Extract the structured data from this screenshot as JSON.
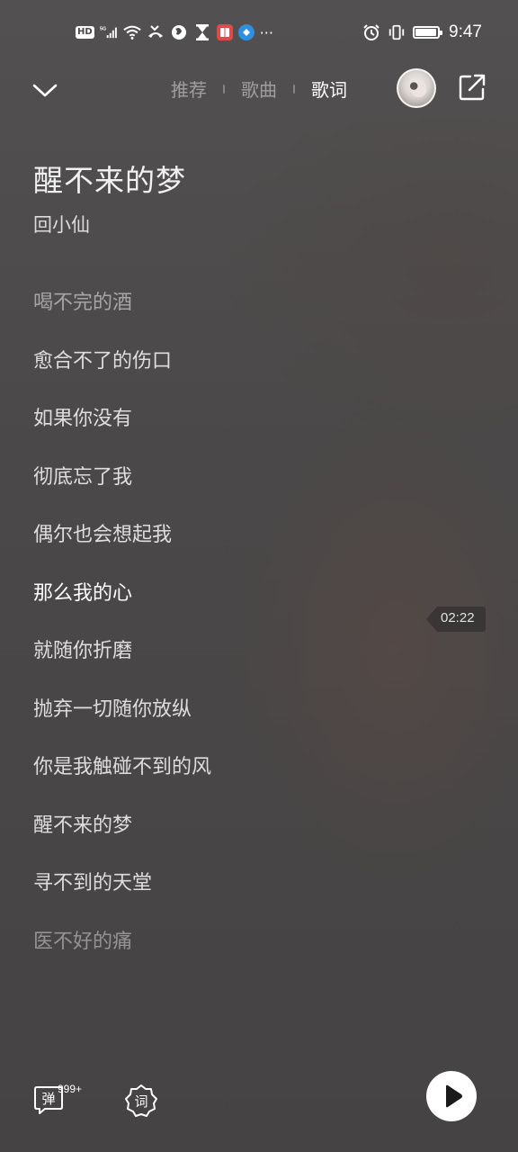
{
  "status_bar": {
    "network": "HD",
    "signal_label": "5G",
    "more": "···",
    "time": "9:47",
    "battery_level": 0.95
  },
  "header": {
    "tabs": [
      {
        "label": "推荐",
        "active": false
      },
      {
        "label": "歌曲",
        "active": false
      },
      {
        "label": "歌词",
        "active": true
      }
    ]
  },
  "song": {
    "title": "醒不来的梦",
    "artist": "回小仙"
  },
  "lyrics": [
    "喝不完的酒",
    "愈合不了的伤口",
    "如果你没有",
    "彻底忘了我",
    "偶尔也会想起我",
    "那么我的心",
    "就随你折磨",
    "抛弃一切随你放纵",
    "你是我触碰不到的风",
    "醒不来的梦",
    "寻不到的天堂",
    "医不好的痛"
  ],
  "current_lyric_index": 5,
  "time_marker": "02:22",
  "bottom_bar": {
    "danmaku_label": "弹",
    "danmaku_count": "999+",
    "lyric_label": "词"
  },
  "colors": {
    "background": "#4a4848",
    "text": "#ffffff"
  }
}
